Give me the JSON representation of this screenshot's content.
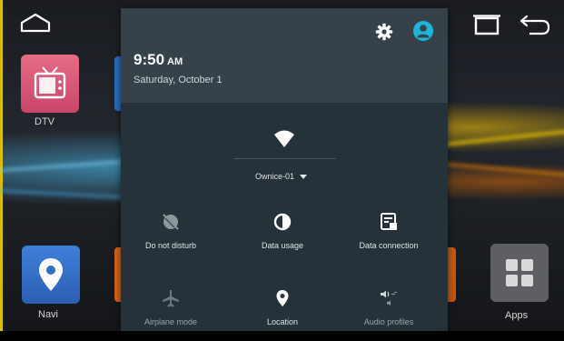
{
  "launcher": {
    "apps": [
      {
        "name": "DTV"
      },
      {
        "name": "Navi"
      },
      {
        "name": "Apps"
      }
    ]
  },
  "shade": {
    "time": "9:50",
    "ampm": "AM",
    "date": "Saturday, October 1",
    "wifi": {
      "network": "Ownice-01"
    },
    "tiles": [
      {
        "label": "Do not disturb",
        "icon": "do-not-disturb-icon",
        "active": false
      },
      {
        "label": "Data usage",
        "icon": "data-usage-icon",
        "active": true
      },
      {
        "label": "Data connection",
        "icon": "data-connection-icon",
        "active": true
      },
      {
        "label": "Airplane mode",
        "icon": "airplane-icon",
        "active": false
      },
      {
        "label": "Location",
        "icon": "location-icon",
        "active": true
      },
      {
        "label": "Audio profiles",
        "icon": "audio-profiles-icon",
        "active": false
      }
    ]
  },
  "colors": {
    "shade_header": "#35424a",
    "shade_body": "#26323a",
    "account_accent": "#1fb3d8"
  }
}
